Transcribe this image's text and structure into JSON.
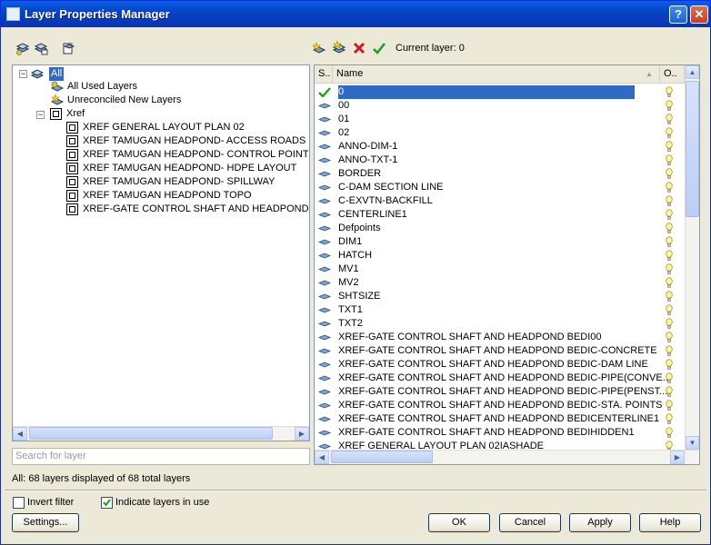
{
  "window": {
    "title": "Layer Properties Manager",
    "help_label": "?",
    "close_label": "✕"
  },
  "toolbar": {
    "current_layer_label": "Current layer: 0"
  },
  "tree": {
    "root": "All",
    "all_used": "All Used Layers",
    "unreconciled": "Unreconciled New Layers",
    "xref": "Xref",
    "xrefs": [
      "XREF GENERAL LAYOUT PLAN 02",
      "XREF TAMUGAN HEADPOND- ACCESS ROADS",
      "XREF TAMUGAN HEADPOND- CONTROL POINTS AN",
      "XREF TAMUGAN HEADPOND- HDPE LAYOUT",
      "XREF TAMUGAN HEADPOND- SPILLWAY",
      "XREF TAMUGAN HEADPOND TOPO",
      "XREF-GATE CONTROL SHAFT AND HEADPOND BEDI"
    ]
  },
  "search": {
    "placeholder": "Search for layer"
  },
  "list": {
    "columns": {
      "status": "S..",
      "name": "Name",
      "on": "O.."
    },
    "layers": [
      "0",
      "00",
      "01",
      "02",
      "ANNO-DIM-1",
      "ANNO-TXT-1",
      "BORDER",
      "C-DAM SECTION LINE",
      "C-EXVTN-BACKFILL",
      "CENTERLINE1",
      "Defpoints",
      "DIM1",
      "HATCH",
      "MV1",
      "MV2",
      "SHTSIZE",
      "TXT1",
      "TXT2",
      "XREF-GATE CONTROL SHAFT AND HEADPOND BEDI00",
      "XREF-GATE CONTROL SHAFT AND HEADPOND BEDIC-CONCRETE",
      "XREF-GATE CONTROL SHAFT AND HEADPOND BEDIC-DAM LINE",
      "XREF-GATE CONTROL SHAFT AND HEADPOND BEDIC-PIPE(CONVE...",
      "XREF-GATE CONTROL SHAFT AND HEADPOND BEDIC-PIPE(PENST...",
      "XREF-GATE CONTROL SHAFT AND HEADPOND BEDIC-STA. POINTS",
      "XREF-GATE CONTROL SHAFT AND HEADPOND BEDICENTERLINE1",
      "XREF-GATE CONTROL SHAFT AND HEADPOND BEDIHIDDEN1",
      "XREF GENERAL LAYOUT PLAN 02IASHADE"
    ],
    "current_index": 0
  },
  "status": {
    "text": "All: 68 layers displayed of 68 total layers"
  },
  "options": {
    "invert_filter": "Invert filter",
    "invert_checked": false,
    "indicate_in_use": "Indicate layers in use",
    "indicate_checked": true
  },
  "buttons": {
    "settings": "Settings...",
    "ok": "OK",
    "cancel": "Cancel",
    "apply": "Apply",
    "help": "Help"
  },
  "colors": {
    "title_bar": "#0843c6",
    "selection": "#316ac5",
    "dialog_bg": "#ece9d8",
    "check_green": "#21a121",
    "delete_red": "#c81e1e"
  }
}
